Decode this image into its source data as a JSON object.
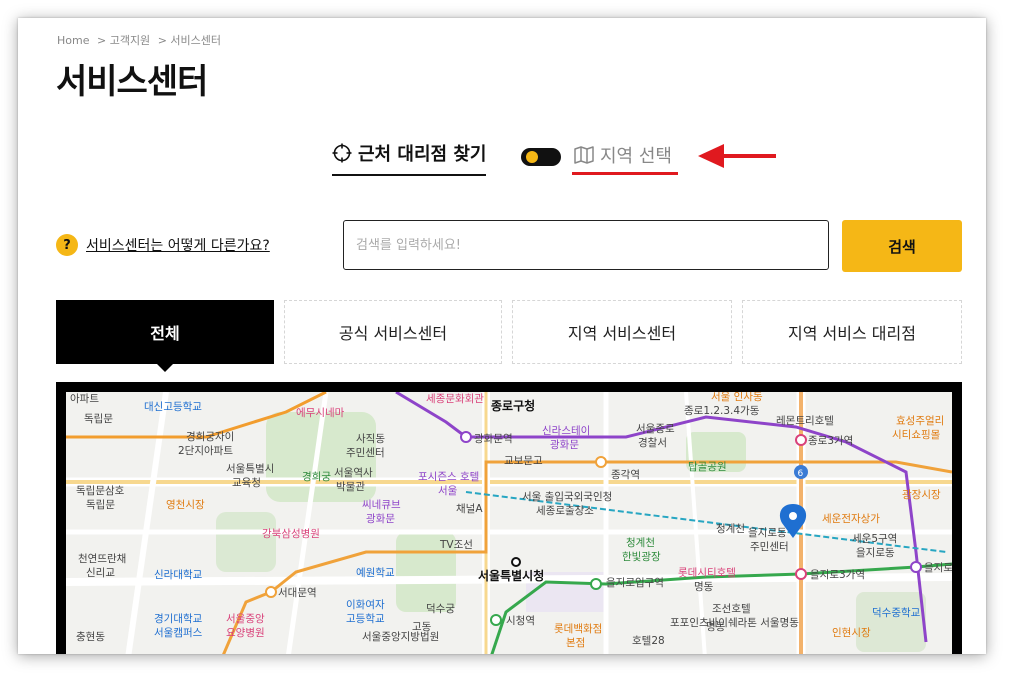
{
  "breadcrumb": [
    "Home",
    "> 고객지원",
    "> 서비스센터"
  ],
  "page_title": "서비스센터",
  "mode": {
    "nearby_label": "근처 대리점 찾기",
    "region_label": "지역 선택",
    "toggle_state": "nearby"
  },
  "help": {
    "icon_text": "?",
    "text": "서비스센터는 어떻게 다른가요?"
  },
  "search": {
    "placeholder": "검색를 입력하세요!",
    "button_label": "검색"
  },
  "tabs": [
    {
      "label": "전체",
      "active": true
    },
    {
      "label": "공식 서비스센터",
      "active": false
    },
    {
      "label": "지역 서비스센터",
      "active": false
    },
    {
      "label": "지역 서비스 대리점",
      "active": false
    }
  ],
  "colors": {
    "accent": "#f5b716",
    "annotation": "#e0191f",
    "dark": "#000000"
  },
  "map": {
    "labels": {
      "l0": "아파트",
      "l1": "세종문화회관",
      "l2": "종로구청",
      "l3": "서울 인사동",
      "l4": "독립문",
      "l5": "대신고등학교",
      "l6": "에무시네마",
      "l7": "종로1.2.3.4가동",
      "l8": "레몬트리호텔",
      "l9": "효성주얼리",
      "l10": "시티쇼핑몰",
      "l11": "사직동",
      "l12": "주민센터",
      "l13": "경희궁자이",
      "l14": "2단지아파트",
      "l15": "광화문역",
      "l16": "신라스테이",
      "l17": "광화문",
      "l18": "서울종로",
      "l19": "경찰서",
      "l20": "종로3가역",
      "l21": "서울특별시",
      "l22": "교육청",
      "l23": "경희궁",
      "l24": "서울역사",
      "l25": "박물관",
      "l26": "교보문고",
      "l27": "포시즌스 호텔",
      "l28": "서울",
      "l29": "종각역",
      "l30": "탑골공원",
      "l31": "광장시장",
      "l32": "독립문삼호",
      "l33": "독립문",
      "l34": "영천시장",
      "l35": "씨네큐브",
      "l36": "광화문",
      "l37": "채널A",
      "l38": "서울 출입국외국인청",
      "l39": "세종로출장소",
      "l40": "청계천",
      "l41": "세운전자상가",
      "l42": "강북삼성병원",
      "l43": "TV조선",
      "l44": "청계천",
      "l45": "한빛광장",
      "l46": "을지로동",
      "l47": "주민센터",
      "l48": "세운5구역",
      "l49": "을지로동",
      "l50": "천연뜨란채",
      "l51": "신리교",
      "l52": "신라대학교",
      "l53": "예원학교",
      "l54": "서울특별시청",
      "l55": "을지로입구역",
      "l56": "롯데시티호텔",
      "l57": "명동",
      "l58": "을지로3가역",
      "l59": "을지로",
      "l60": "서대문역",
      "l61": "이화여자",
      "l62": "고등학교",
      "l63": "덕수궁",
      "l64": "조선호텔",
      "l65": "덕수중학교",
      "l66": "경기대학교",
      "l67": "서울캠퍼스",
      "l68": "서울중앙",
      "l69": "요양병원",
      "l70": "충현동",
      "l71": "고동",
      "l72": "서울중앙지방법원",
      "l73": "시청역",
      "l74": "롯데백화점",
      "l75": "본점",
      "l76": "포포인츠바이쉐라톤 서울명동",
      "l77": "인현시장",
      "l78": "호텔28",
      "l79": "명동"
    }
  }
}
